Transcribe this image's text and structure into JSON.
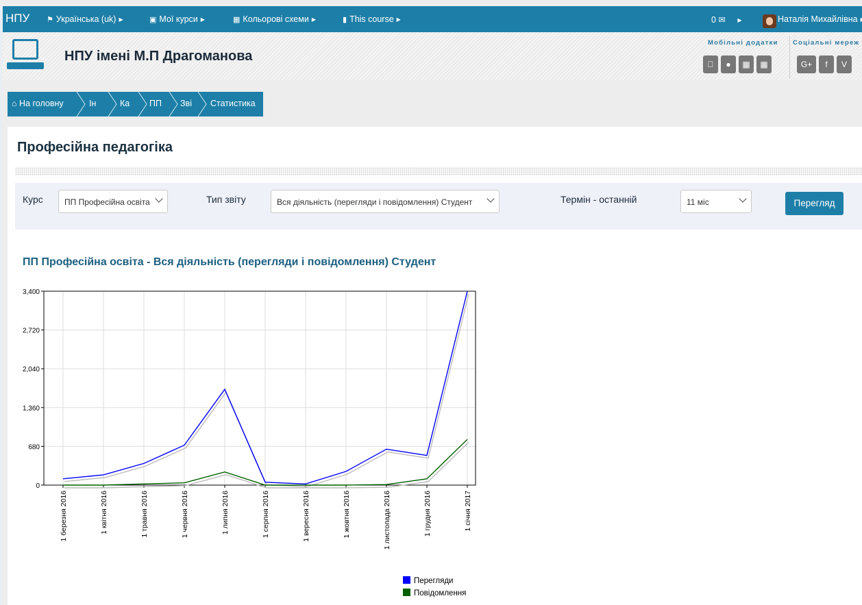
{
  "topnav": {
    "brand": "НПУ",
    "items": [
      {
        "label": "Українська (uk)",
        "icon": "flag-icon"
      },
      {
        "label": "Мої курси",
        "icon": "briefcase-icon"
      },
      {
        "label": "Кольорові схеми",
        "icon": "grid-icon"
      },
      {
        "label": "This course",
        "icon": "book-icon"
      }
    ],
    "messages": "0 ✉",
    "user_name": "Наталія Михайлівна"
  },
  "header": {
    "site_title": "НПУ імені М.П Драгоманова",
    "apps_label": "Мобільні додатки",
    "social_label": "Соціальні мереж",
    "app_icons": [
      "apple-icon",
      "android-icon",
      "windows-icon",
      "windows-phone-icon"
    ],
    "social_icons": [
      {
        "icon": "google-plus-icon",
        "glyph": "G+"
      },
      {
        "icon": "facebook-icon",
        "glyph": "f"
      },
      {
        "icon": "vk-icon",
        "glyph": "V"
      }
    ]
  },
  "breadcrumb": {
    "home_label": "На головну",
    "items": [
      "Ін",
      "Ка",
      "ПП",
      "Зві",
      "Статистика"
    ]
  },
  "page": {
    "title": "Професійна педагогіка"
  },
  "filters": {
    "course_label": "Курс",
    "course_value": "ПП Професійна освіта",
    "report_label": "Тип звіту",
    "report_value": "Вся діяльність (перегляди і повідомлення) Студент",
    "period_label": "Термін - останній",
    "period_value": "11 міс",
    "view_button": "Перегляд"
  },
  "chart_title": "ПП Професійна освіта - Вся діяльність (перегляди і повідомлення) Студент",
  "chart_data": {
    "type": "line",
    "x": [
      "1 березня 2016",
      "1 квітня 2016",
      "1 травня 2016",
      "1 червня 2016",
      "1 липня 2016",
      "1 серпня 2016",
      "1 вересня 2016",
      "1 жовтня 2016",
      "1 листопада 2016",
      "1 грудня 2016",
      "1 січня 2017"
    ],
    "ylim": [
      0,
      3400
    ],
    "yticks": [
      "0",
      "680",
      "1,360",
      "2,040",
      "2,720",
      "3,400"
    ],
    "ytick_values": [
      0,
      680,
      1360,
      2040,
      2720,
      3400
    ],
    "grid": true,
    "legend": "bottom-right",
    "series": [
      {
        "name": "Перегляди",
        "color": "#0000ff",
        "values": [
          110,
          180,
          380,
          700,
          1680,
          50,
          20,
          240,
          630,
          520,
          3400
        ]
      },
      {
        "name": "Повідомлення",
        "color": "#006000",
        "values": [
          0,
          0,
          20,
          40,
          230,
          0,
          0,
          0,
          10,
          110,
          800
        ]
      }
    ]
  }
}
